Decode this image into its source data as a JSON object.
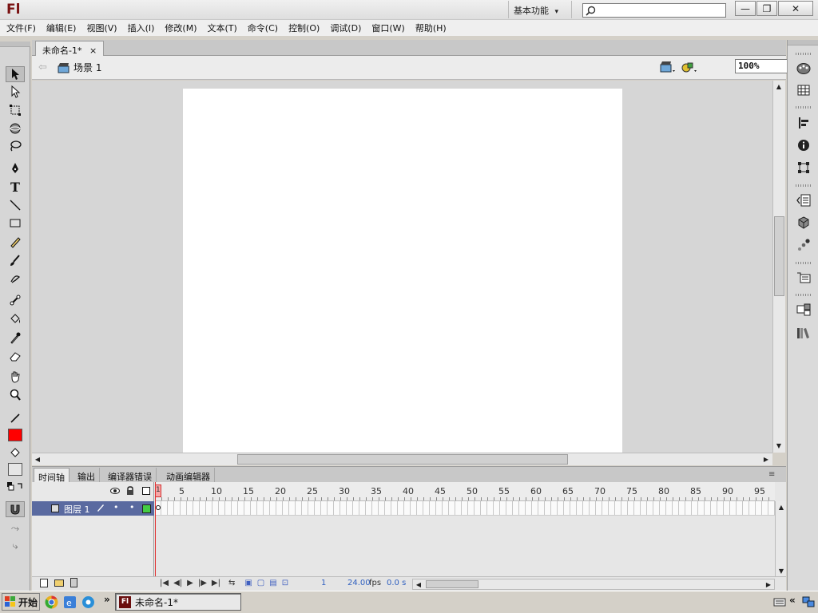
{
  "app": {
    "logo": "Fl",
    "workspace": "基本功能",
    "workspace_arrow": "▾"
  },
  "window_buttons": {
    "minimize": "—",
    "restore": "❐",
    "close": "✕"
  },
  "menus": [
    "文件(F)",
    "编辑(E)",
    "视图(V)",
    "插入(I)",
    "修改(M)",
    "文本(T)",
    "命令(C)",
    "控制(O)",
    "调试(D)",
    "窗口(W)",
    "帮助(H)"
  ],
  "document": {
    "tab_title": "未命名-1*",
    "tab_close": "×",
    "scene": "场景 1",
    "zoom": "100%"
  },
  "timeline": {
    "tabs": [
      "时间轴",
      "输出",
      "编译器错误",
      "动画编辑器"
    ],
    "ruler": [
      "1",
      "5",
      "10",
      "15",
      "20",
      "25",
      "30",
      "35",
      "40",
      "45",
      "50",
      "55",
      "60",
      "65",
      "70",
      "75",
      "80",
      "85",
      "90",
      "95"
    ],
    "layer_name": "图层 1",
    "current_frame": "1",
    "fps": "24.00",
    "fps_unit": "fps",
    "elapsed": "0.0 s"
  },
  "colors": {
    "stroke": "#222222",
    "fill": "#ff0000",
    "layer_color": "#44cc44",
    "accent": "#5a6aa0"
  },
  "taskbar": {
    "start": "开始",
    "task_title": "未命名-1*",
    "chevron_left": "»",
    "chevron_right": "«"
  }
}
